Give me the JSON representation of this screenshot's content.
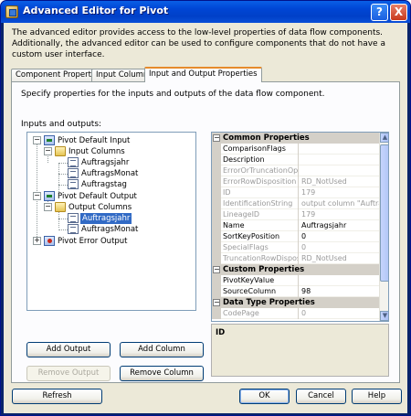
{
  "window": {
    "title": "Advanced Editor for Pivot",
    "help_glyph": "?",
    "close_glyph": "X"
  },
  "description": "The advanced editor provides access to the low-level properties of data flow components. Additionally, the advanced editor can be used to configure components that do not have a custom user interface.",
  "tabs": [
    {
      "label": "Component Properties"
    },
    {
      "label": "Input Columns"
    },
    {
      "label": "Input and Output Properties"
    }
  ],
  "panel": {
    "description": "Specify properties for the inputs and outputs of the data flow component.",
    "tree_label": "Inputs and outputs:"
  },
  "tree": {
    "nodes": [
      {
        "label": "Pivot Default Input",
        "expander": "−"
      },
      {
        "label": "Input Columns",
        "expander": "−"
      },
      {
        "label": "Auftragsjahr"
      },
      {
        "label": "AuftragsMonat"
      },
      {
        "label": "Auftragstag"
      },
      {
        "label": "Pivot Default Output",
        "expander": "−"
      },
      {
        "label": "Output Columns",
        "expander": "−"
      },
      {
        "label": "Auftragsjahr",
        "selected": true
      },
      {
        "label": "AuftragsMonat"
      },
      {
        "label": "Pivot Error Output",
        "expander": "+"
      }
    ]
  },
  "properties": {
    "categories": [
      {
        "name": "Common Properties",
        "expander": "−"
      },
      {
        "name": "Custom Properties",
        "expander": "−"
      },
      {
        "name": "Data Type Properties",
        "expander": "−"
      }
    ],
    "common": [
      {
        "name": "ComparisonFlags",
        "value": "",
        "readonly": false
      },
      {
        "name": "Description",
        "value": "",
        "readonly": false
      },
      {
        "name": "ErrorOrTruncationOpe",
        "value": "",
        "readonly": true
      },
      {
        "name": "ErrorRowDisposition",
        "value": "RD_NotUsed",
        "readonly": true
      },
      {
        "name": "ID",
        "value": "179",
        "readonly": true
      },
      {
        "name": "IdentificationString",
        "value": "output column \"Auftragsja",
        "readonly": true
      },
      {
        "name": "LineageID",
        "value": "179",
        "readonly": true
      },
      {
        "name": "Name",
        "value": "Auftragsjahr",
        "readonly": false
      },
      {
        "name": "SortKeyPosition",
        "value": "0",
        "readonly": false
      },
      {
        "name": "SpecialFlags",
        "value": "0",
        "readonly": true
      },
      {
        "name": "TruncationRowDisposit",
        "value": "RD_NotUsed",
        "readonly": true
      }
    ],
    "custom": [
      {
        "name": "PivotKeyValue",
        "value": "",
        "readonly": false
      },
      {
        "name": "SourceColumn",
        "value": "98",
        "readonly": false
      }
    ],
    "datatype": [
      {
        "name": "CodePage",
        "value": "0",
        "readonly": true
      }
    ],
    "description_title": "ID"
  },
  "buttons": {
    "add_output": "Add Output",
    "add_column": "Add Column",
    "remove_output": "Remove Output",
    "remove_column": "Remove Column",
    "refresh": "Refresh",
    "ok": "OK",
    "cancel": "Cancel",
    "help": "Help"
  },
  "colors": {
    "titlebar": "#0046d5",
    "selection": "#316ac5",
    "dialog_bg": "#ece9d8"
  }
}
